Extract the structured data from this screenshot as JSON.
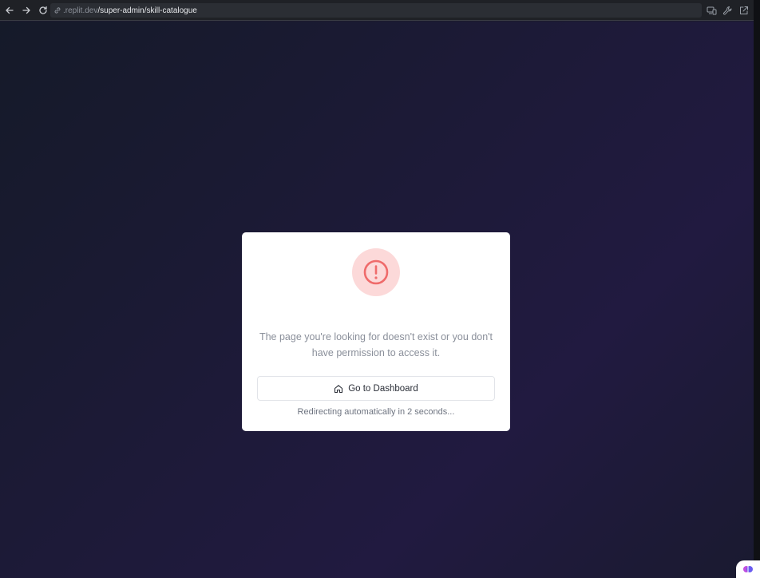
{
  "browser": {
    "url_host": ".replit.dev",
    "url_path": "/super-admin/skill-catalogue"
  },
  "card": {
    "message": "The page you're looking for doesn't exist or you don't have permission to access it.",
    "button_label": "Go to Dashboard",
    "redirect_text": "Redirecting automatically in 2 seconds..."
  },
  "colors": {
    "background": "#1d1a38",
    "card": "#ffffff",
    "alert_circle_bg": "#fcd9d9",
    "alert_icon": "#ef6b6b"
  },
  "icons": {
    "back": "arrow-left-icon",
    "forward": "arrow-right-icon",
    "reload": "reload-icon",
    "link": "link-icon",
    "devices": "devices-icon",
    "tools": "wrench-icon",
    "open_external": "external-link-icon",
    "alert": "alert-circle-icon",
    "home": "home-icon"
  }
}
